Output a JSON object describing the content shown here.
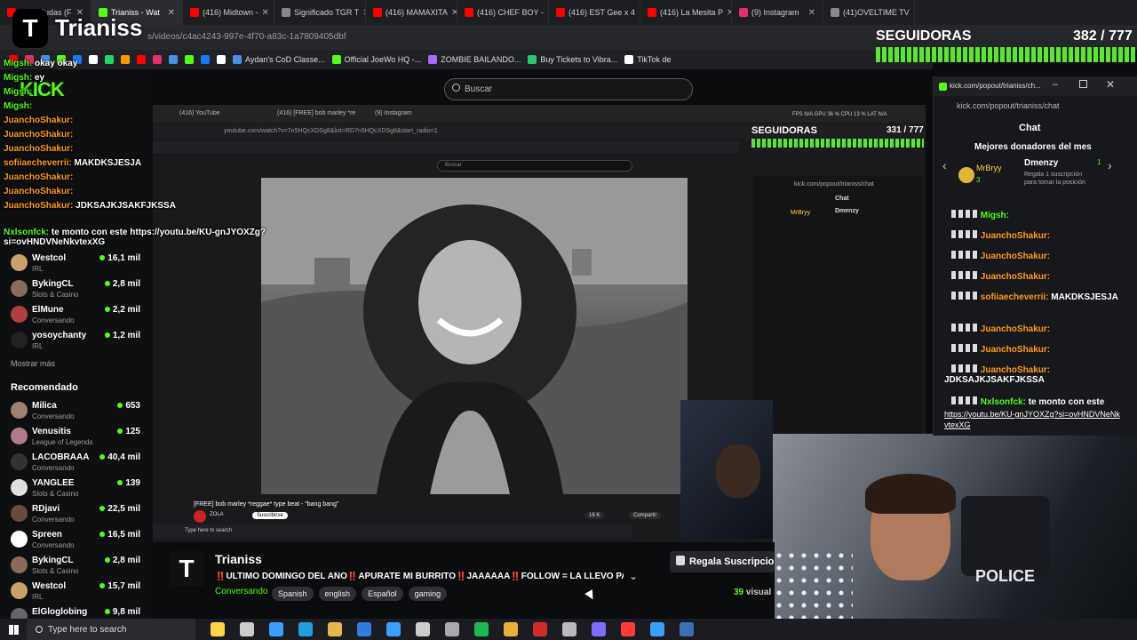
{
  "browser": {
    "tabs": [
      {
        "label": "(416) Judas (F",
        "color": "#ff0000"
      },
      {
        "label": "Trianiss - Wat",
        "color": "#53fc18"
      },
      {
        "label": "(416) Midtown -",
        "color": "#ff0000"
      },
      {
        "label": "Significado TGR T",
        "color": "#888888"
      },
      {
        "label": "(416) MAMAXITA",
        "color": "#ff0000"
      },
      {
        "label": "(416) CHEF BOY -",
        "color": "#ff0000"
      },
      {
        "label": "(416) EST Gee x 4",
        "color": "#ff0000"
      },
      {
        "label": "(416) La Mesita P",
        "color": "#ff0000"
      },
      {
        "label": "(9) Instagram",
        "color": "#e1306c"
      },
      {
        "label": "(41)OVELTIME TV",
        "color": "#888888"
      }
    ],
    "url": "s/videos/c4ac4243-997e-4f70-a83c-1a7809405dbf",
    "bookmarks": [
      {
        "label": "Aydan's CoD Classe...",
        "color": "#4a90e2"
      },
      {
        "label": "Official JoeWo HQ -...",
        "color": "#53fc18"
      },
      {
        "label": "ZOMBIE BAILANDO...",
        "color": "#a46cff"
      },
      {
        "label": "Buy Tickets to Vibra...",
        "color": "#2ec46a"
      },
      {
        "label": "TikTok de",
        "color": "#ffffff"
      }
    ]
  },
  "overlay": {
    "brand": "Trianiss",
    "brand_letter": "T",
    "kick_logo": "KICK",
    "followers_label": "SEGUIDORAS",
    "followers_count": "382 / 777"
  },
  "chat_overlay": [
    {
      "user": "Migsh:",
      "text": "okay okay",
      "color": "u-g"
    },
    {
      "user": "Migsh:",
      "text": "ey",
      "color": "u-g"
    },
    {
      "user": "Migsh:",
      "text": "",
      "color": "u-g"
    },
    {
      "user": "Migsh:",
      "text": "",
      "color": "u-g"
    },
    {
      "user": "JuanchoShakur:",
      "text": "",
      "color": "u-o"
    },
    {
      "user": "JuanchoShakur:",
      "text": "",
      "color": "u-o"
    },
    {
      "user": "JuanchoShakur:",
      "text": "",
      "color": "u-o"
    },
    {
      "user": "sofiiaecheverrii:",
      "text": "MAKDKSJESJA",
      "color": "u-o"
    },
    {
      "user": "JuanchoShakur:",
      "text": "",
      "color": "u-o"
    },
    {
      "user": "JuanchoShakur:",
      "text": "",
      "color": "u-o"
    },
    {
      "user": "JuanchoShakur:",
      "text": "JDKSAJKJSAKFJKSSA",
      "color": "u-o"
    },
    {
      "user": "Nxlsonfck:",
      "text": "te monto con este https://youtu.be/KU-gnJYOXZg?si=ovHNDVNeNkvtexXG",
      "color": "u-g"
    }
  ],
  "sidebar": {
    "following": [
      {
        "name": "Westcol",
        "sub": "IRL",
        "viewers": "16,1 mil",
        "color": "#c8a06a"
      },
      {
        "name": "BykingCL",
        "sub": "Slots & Casino",
        "viewers": "2,8 mil",
        "color": "#8a6a5a"
      },
      {
        "name": "ElMune",
        "sub": "Conversando",
        "viewers": "2,2 mil",
        "color": "#b04040"
      },
      {
        "name": "yosoychanty",
        "sub": "IRL",
        "viewers": "1,2 mil",
        "color": "#222222"
      }
    ],
    "show_more": "Mostrar más",
    "recommended_title": "Recomendado",
    "recommended": [
      {
        "name": "Milica",
        "sub": "Conversando",
        "viewers": "653",
        "color": "#a08070"
      },
      {
        "name": "Venusitis",
        "sub": "League of Legends",
        "viewers": "125",
        "color": "#b07a8a"
      },
      {
        "name": "LACOBRAAA",
        "sub": "Conversando",
        "viewers": "40,4 mil",
        "color": "#333333"
      },
      {
        "name": "YANGLEE",
        "sub": "Slots & Casino",
        "viewers": "139",
        "color": "#e0e0e0"
      },
      {
        "name": "RDjavi",
        "sub": "Conversando",
        "viewers": "22,5 mil",
        "color": "#6a4a3a"
      },
      {
        "name": "Spreen",
        "sub": "Conversando",
        "viewers": "16,5 mil",
        "color": "#ffffff"
      },
      {
        "name": "BykingCL",
        "sub": "Slots & Casino",
        "viewers": "2,8 mil",
        "color": "#8a6a5a"
      },
      {
        "name": "Westcol",
        "sub": "IRL",
        "viewers": "15,7 mil",
        "color": "#c8a06a"
      },
      {
        "name": "ElGloglobing",
        "sub": "",
        "viewers": "9,8 mil",
        "color": "#666666"
      }
    ]
  },
  "stream": {
    "search_placeholder": "Buscar",
    "inner_url": "youtube.com/watch?v=7n5HQcXDSg8&list=RD7n5HQcXDSg8&start_radio=1",
    "inner_tabs": [
      "(416) YouTube",
      "(416) [FREE] bob marley *re",
      "(9) Instagram"
    ],
    "inner_followers": "SEGUIDORAS",
    "inner_followers_count": "331 / 777",
    "stats": "FPS N/A   GPU 36 %   CPU 13 %   LAT N/A",
    "video_title": "[FREE] bob marley *reggae* type beat - \"bang bang\"",
    "channel_name": "ZOLA",
    "subscribe": "Suscribirse",
    "likes": "16 K",
    "share": "Compartir",
    "inner_search": "Buscar",
    "inner_type_here": "Type here to search"
  },
  "kick_chat": {
    "window_title": "kick.com/popout/trianiss/ch...",
    "url": "kick.com/popout/trianiss/chat",
    "title": "Chat",
    "donors_title": "Mejores donadores del mes",
    "donor1": "MrBryy",
    "donor1_count": "3",
    "donor2": "Dmenzy",
    "donor2_count": "1",
    "donor2_note": "Regala 1 suscripción para tomar la posición",
    "messages": [
      {
        "user": "Migsh:",
        "text": "",
        "color": "#53fc18"
      },
      {
        "user": "JuanchoShakur:",
        "text": "",
        "color": "#ff9b1f"
      },
      {
        "user": "JuanchoShakur:",
        "text": "",
        "color": "#ff9b1f"
      },
      {
        "user": "JuanchoShakur:",
        "text": "",
        "color": "#ff9b1f"
      },
      {
        "user": "sofiiaecheverrii:",
        "text": "MAKDKSJESJA",
        "color": "#ff9b1f"
      },
      {
        "user": "JuanchoShakur:",
        "text": "",
        "color": "#ff9b1f"
      },
      {
        "user": "JuanchoShakur:",
        "text": "",
        "color": "#ff9b1f"
      },
      {
        "user": "JuanchoShakur:",
        "text": "JDKSAJKJSAKFJKSSA",
        "color": "#ff9b1f"
      },
      {
        "user": "Nxlsonfck:",
        "text": "te monto con este",
        "color": "#53fc18"
      }
    ],
    "link": "https://youtu.be/KU-gnJYOXZg?si=ovHNDVNeNkvtexXG"
  },
  "channel": {
    "name": "Trianiss",
    "avatar_letter": "T",
    "title": "‼️ULTIMO DOMINGO DEL AÑO‼️APURATE MI BURRITO‼️JAAAAAA‼️FOLLOW = LA LLEVO PA MO...",
    "category": "Conversando",
    "tags": [
      "Spanish",
      "english",
      "Español",
      "gaming"
    ],
    "gift_button": "Regala Suscripcio",
    "viewers": "39",
    "viewers_label": "visual",
    "cam_text": "POLICE"
  },
  "taskbar": {
    "search": "Type here to search",
    "icons": [
      "#ffd54a",
      "#cccccc",
      "#3aa0ff",
      "#1f9fe0",
      "#e6b84a",
      "#2f7de1",
      "#3aa0ff",
      "#cccccc",
      "#aaaaaa",
      "#1db954",
      "#e8b23a",
      "#d12b2b",
      "#bbbbbb",
      "#7e6cff",
      "#ff3b3b",
      "#3aa0ff",
      "#3b6fb6"
    ]
  }
}
